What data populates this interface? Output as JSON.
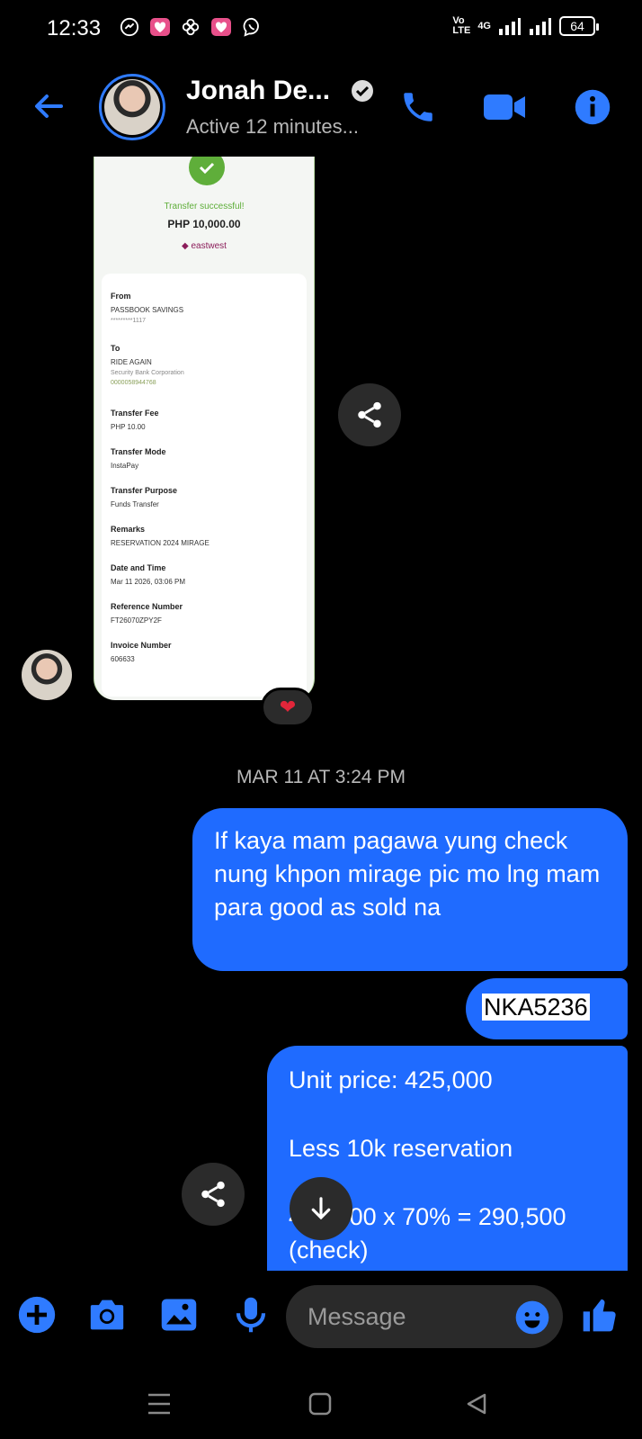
{
  "status_bar": {
    "time": "12:33",
    "volte": "VoLTE",
    "network": "4G",
    "battery": "64",
    "notification_icons": [
      "messenger-icon",
      "app-icon",
      "pinwheel-icon",
      "app-icon",
      "viber-icon"
    ]
  },
  "header": {
    "name": "Jonah De...",
    "status": "Active 12 minutes..."
  },
  "receipt": {
    "title": "Transfer successful!",
    "amount": "PHP 10,000.00",
    "bank": "eastwest",
    "from_label": "From",
    "from_account": "PASSBOOK SAVINGS",
    "from_number": "*********1117",
    "to_label": "To",
    "to_name": "RIDE AGAIN",
    "to_bank": "Security Bank Corporation",
    "to_number": "0000058944768",
    "fee_label": "Transfer Fee",
    "fee_value": "PHP 10.00",
    "mode_label": "Transfer Mode",
    "mode_value": "InstaPay",
    "purpose_label": "Transfer Purpose",
    "purpose_value": "Funds Transfer",
    "remarks_label": "Remarks",
    "remarks_value": "RESERVATION 2024 MIRAGE",
    "date_label": "Date and Time",
    "date_value": "Mar 11 2026, 03:06 PM",
    "ref_label": "Reference Number",
    "ref_value": "FT26070ZPY2F",
    "invoice_label": "Invoice Number",
    "invoice_value": "606633"
  },
  "reaction": "❤",
  "timestamp": "MAR 11 AT 3:24 PM",
  "messages": [
    "If kaya mam pagawa yung check nung khpon mirage pic mo lng mam para good as sold na",
    "NKA5236"
  ],
  "message3": {
    "line1": "Unit price: 425,000",
    "line2": "Less 10k reservation",
    "line3": "415,000 x 70% = 290,500",
    "line4": "(check)"
  },
  "composer": {
    "placeholder": "Message"
  },
  "colors": {
    "accent": "#1f6bff",
    "background": "#000000",
    "bubble_dark": "#2b2b2b"
  }
}
